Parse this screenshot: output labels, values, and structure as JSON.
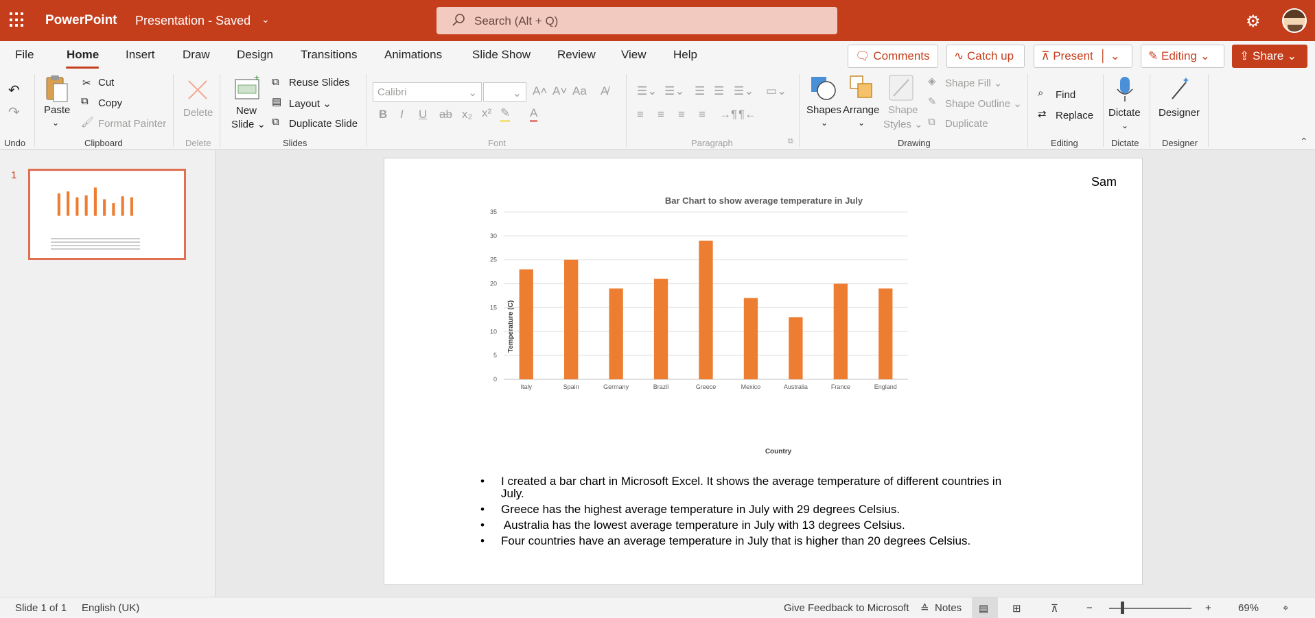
{
  "app": {
    "name": "PowerPoint",
    "doc_title": "Presentation - Saved",
    "search_placeholder": "Search (Alt + Q)"
  },
  "tabs": [
    "File",
    "Home",
    "Insert",
    "Draw",
    "Design",
    "Transitions",
    "Animations",
    "Slide Show",
    "Review",
    "View",
    "Help"
  ],
  "active_tab": "Home",
  "top_buttons": {
    "comments": "Comments",
    "catch_up": "Catch up",
    "present": "Present",
    "editing": "Editing",
    "share": "Share"
  },
  "ribbon": {
    "undo_label": "Undo",
    "clipboard": {
      "paste": "Paste",
      "cut": "Cut",
      "copy": "Copy",
      "format_painter": "Format Painter",
      "label": "Clipboard"
    },
    "delete": {
      "button": "Delete",
      "label": "Delete"
    },
    "slides": {
      "new_slide_1": "New",
      "new_slide_2": "Slide",
      "reuse": "Reuse Slides",
      "layout": "Layout",
      "duplicate": "Duplicate Slide",
      "label": "Slides"
    },
    "font": {
      "family": "Calibri",
      "label": "Font"
    },
    "paragraph": {
      "label": "Paragraph"
    },
    "drawing": {
      "shapes": "Shapes",
      "arrange": "Arrange",
      "shape_styles_1": "Shape",
      "shape_styles_2": "Styles",
      "shape_fill": "Shape Fill",
      "shape_outline": "Shape Outline",
      "duplicate": "Duplicate",
      "label": "Drawing"
    },
    "editing": {
      "find": "Find",
      "replace": "Replace",
      "label": "Editing"
    },
    "dictate": {
      "button": "Dictate",
      "label": "Dictate"
    },
    "designer": {
      "button": "Designer",
      "label": "Designer"
    }
  },
  "thumbnail": {
    "number": "1"
  },
  "slide": {
    "author": "Sam",
    "bullets": [
      "I created a bar chart in Microsoft Excel. It shows the average temperature of different countries in July.",
      "Greece has the highest average temperature in July with 29 degrees Celsius.",
      " Australia has the lowest average temperature in July with 13 degrees Celsius.",
      "Four countries have an average temperature in July that is higher than 20 degrees Celsius."
    ]
  },
  "chart_data": {
    "type": "bar",
    "title": "Bar Chart to show average temperature in July",
    "xlabel": "Country",
    "ylabel": "Temperature (C)",
    "categories": [
      "Italy",
      "Spain",
      "Germany",
      "Brazil",
      "Greece",
      "Mexico",
      "Australia",
      "France",
      "England"
    ],
    "values": [
      23,
      25,
      19,
      21,
      29,
      17,
      13,
      20,
      19
    ],
    "ylim": [
      0,
      35
    ],
    "yticks": [
      0,
      5,
      10,
      15,
      20,
      25,
      30,
      35
    ],
    "grid": true,
    "bar_color": "#ed7d31"
  },
  "status": {
    "slide_of": "Slide 1 of 1",
    "language": "English (UK)",
    "feedback": "Give Feedback to Microsoft",
    "notes": "Notes",
    "zoom": "69%"
  },
  "colors": {
    "accent": "#c43e1c",
    "bar": "#ed7d31"
  }
}
